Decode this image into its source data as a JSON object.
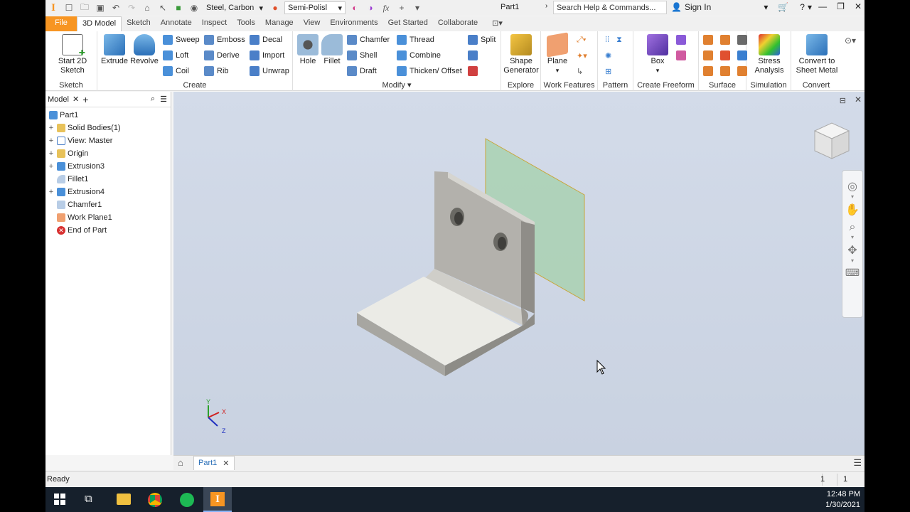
{
  "app": {
    "title": "Part1",
    "search_placeholder": "Search Help & Commands...",
    "signin": "Sign In",
    "material": "Steel, Carbon",
    "appearance": "Semi-Polisl"
  },
  "tabs": [
    "File",
    "3D Model",
    "Sketch",
    "Annotate",
    "Inspect",
    "Tools",
    "Manage",
    "View",
    "Environments",
    "Get Started",
    "Collaborate"
  ],
  "ribbon": {
    "sketch": {
      "label": "Sketch",
      "start_sketch": "Start 2D Sketch"
    },
    "create": {
      "label": "Create",
      "extrude": "Extrude",
      "revolve": "Revolve",
      "sweep": "Sweep",
      "loft": "Loft",
      "coil": "Coil",
      "emboss": "Emboss",
      "derive": "Derive",
      "rib": "Rib",
      "decal": "Decal",
      "import": "Import",
      "unwrap": "Unwrap"
    },
    "modify": {
      "label": "Modify",
      "hole": "Hole",
      "fillet": "Fillet",
      "chamfer": "Chamfer",
      "shell": "Shell",
      "draft": "Draft",
      "thread": "Thread",
      "combine": "Combine",
      "thicken": "Thicken/ Offset",
      "split": "Split"
    },
    "explore": {
      "label": "Explore",
      "shape_generator": "Shape Generator"
    },
    "work_features": {
      "label": "Work Features",
      "plane": "Plane"
    },
    "pattern": {
      "label": "Pattern"
    },
    "freeform": {
      "label": "Create Freeform",
      "box": "Box"
    },
    "surface": {
      "label": "Surface"
    },
    "simulation": {
      "label": "Simulation",
      "stress": "Stress Analysis"
    },
    "convert": {
      "label": "Convert",
      "sheet_metal": "Convert to Sheet Metal"
    }
  },
  "browser": {
    "tab": "Model",
    "items": [
      {
        "label": "Part1",
        "expand": ""
      },
      {
        "label": "Solid Bodies(1)",
        "expand": "+"
      },
      {
        "label": "View: Master",
        "expand": "+"
      },
      {
        "label": "Origin",
        "expand": "+"
      },
      {
        "label": "Extrusion3",
        "expand": "+"
      },
      {
        "label": "Fillet1",
        "expand": ""
      },
      {
        "label": "Extrusion4",
        "expand": "+"
      },
      {
        "label": "Chamfer1",
        "expand": ""
      },
      {
        "label": "Work Plane1",
        "expand": ""
      },
      {
        "label": "End of Part",
        "expand": ""
      }
    ]
  },
  "axes": {
    "x": "X",
    "y": "Y",
    "z": "Z"
  },
  "document_tab": "Part1",
  "status": {
    "text": "Ready",
    "count1": "1",
    "count2": "1"
  },
  "taskbar": {
    "time": "12:48 PM",
    "date": "1/30/2021"
  },
  "colors": {
    "accent": "#f79522",
    "viewport": "#cfd7e6",
    "taskbar": "#16202c"
  }
}
